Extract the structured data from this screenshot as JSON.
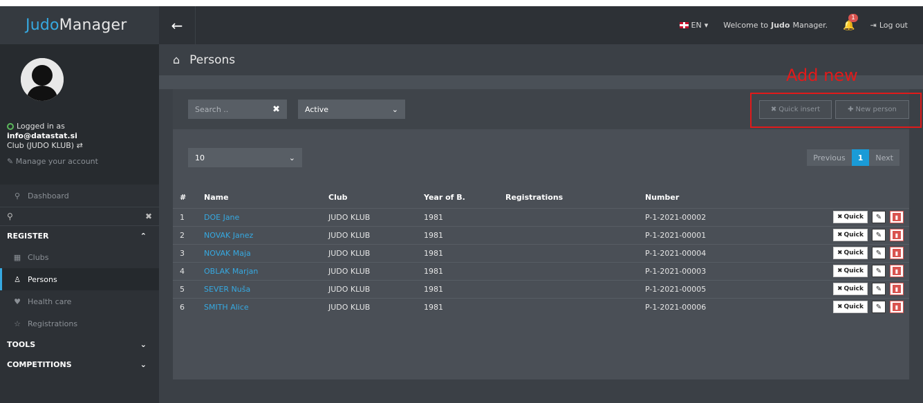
{
  "brand": {
    "part1": "Judo",
    "part2": "Manager"
  },
  "profile": {
    "logged_in_label": "Logged in as",
    "email": "info@datastat.si",
    "club": "Club (JUDO KLUB)",
    "manage": "Manage your account"
  },
  "sidebar": {
    "dashboard": "Dashboard",
    "register_label": "REGISTER",
    "items": [
      {
        "label": "Clubs",
        "icon": "building-icon"
      },
      {
        "label": "Persons",
        "icon": "person-icon"
      },
      {
        "label": "Health care",
        "icon": "heart-icon"
      },
      {
        "label": "Registrations",
        "icon": "star-icon"
      }
    ],
    "tools_label": "TOOLS",
    "competitions_label": "COMPETITIONS"
  },
  "topbar": {
    "language": "EN",
    "welcome_prefix": "Welcome to ",
    "welcome_bold": "Judo",
    "welcome_suffix": "Manager.",
    "notifications": "1",
    "logout": "Log out"
  },
  "page": {
    "title": "Persons"
  },
  "toolbar": {
    "search_placeholder": "Search ..",
    "status_value": "Active",
    "quick_insert": "Quick insert",
    "new_person": "New person",
    "annotation": "Add new"
  },
  "paging": {
    "page_size": "10",
    "previous": "Previous",
    "current": "1",
    "next": "Next"
  },
  "table": {
    "headers": [
      "#",
      "Name",
      "Club",
      "Year of B.",
      "Registrations",
      "Number"
    ],
    "quick_label": "Quick",
    "rows": [
      {
        "n": "1",
        "name": "DOE Jane",
        "club": "JUDO KLUB",
        "year": "1981",
        "reg": "",
        "number": "P-1-2021-00002"
      },
      {
        "n": "2",
        "name": "NOVAK Janez",
        "club": "JUDO KLUB",
        "year": "1981",
        "reg": "",
        "number": "P-1-2021-00001"
      },
      {
        "n": "3",
        "name": "NOVAK Maja",
        "club": "JUDO KLUB",
        "year": "1981",
        "reg": "",
        "number": "P-1-2021-00004"
      },
      {
        "n": "4",
        "name": "OBLAK Marjan",
        "club": "JUDO KLUB",
        "year": "1981",
        "reg": "",
        "number": "P-1-2021-00003"
      },
      {
        "n": "5",
        "name": "SEVER Nuša",
        "club": "JUDO KLUB",
        "year": "1981",
        "reg": "",
        "number": "P-1-2021-00005"
      },
      {
        "n": "6",
        "name": "SMITH Alice",
        "club": "JUDO KLUB",
        "year": "1981",
        "reg": "",
        "number": "P-1-2021-00006"
      }
    ]
  },
  "colors": {
    "accent": "#36a9e1",
    "annotation": "#e11a1a",
    "sidebar": "#2d3136"
  }
}
